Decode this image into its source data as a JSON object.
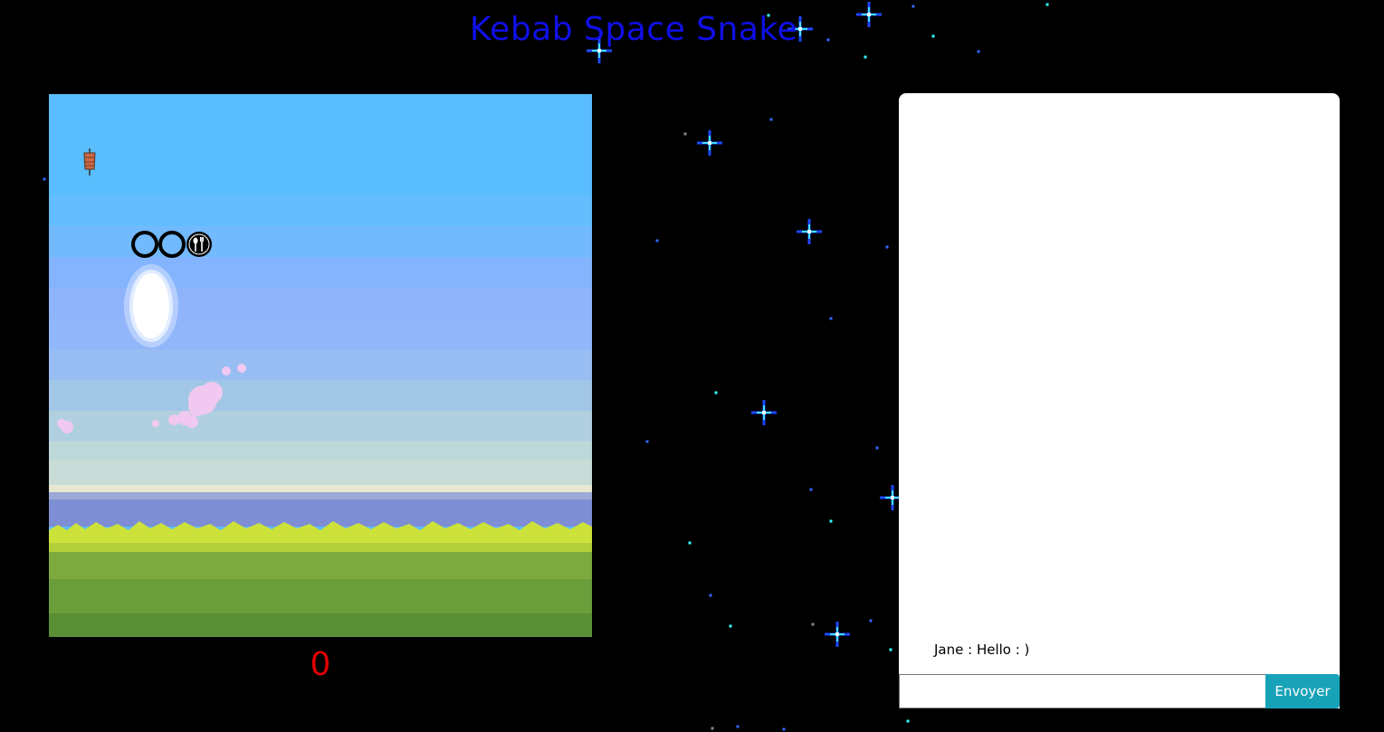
{
  "page": {
    "title": "Kebab Space Snake"
  },
  "game": {
    "score": "0",
    "snake_segments": [
      "ring",
      "ring",
      "head"
    ],
    "food_icon": "kebab-icon",
    "colors": {
      "sky": "#59bdfe",
      "grass": "#cce23a",
      "ground": "#5e9a3a"
    }
  },
  "chat": {
    "messages": [
      {
        "author": "Jane",
        "text": "Jane : Hello : )"
      }
    ],
    "input": {
      "value": "",
      "placeholder": ""
    },
    "send_label": "Envoyer",
    "colors": {
      "send_button": "#17a2b8"
    }
  },
  "colors": {
    "title": "#1010e8",
    "score": "#e00000",
    "background": "#000000"
  }
}
